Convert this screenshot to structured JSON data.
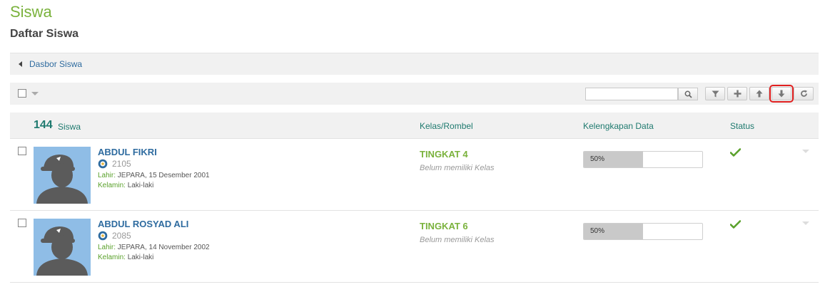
{
  "page": {
    "title": "Siswa",
    "subtitle": "Daftar Siswa"
  },
  "breadcrumb": {
    "link": "Dasbor Siswa"
  },
  "toolbar": {
    "search_value": "",
    "buttons": [
      "filter-icon",
      "plus-icon",
      "arrow-up-icon",
      "arrow-down-icon",
      "refresh-icon"
    ]
  },
  "list": {
    "count": "144",
    "count_label": "Siswa",
    "columns": {
      "kelas": "Kelas/Rombel",
      "kelengkapan": "Kelengkapan Data",
      "status": "Status"
    }
  },
  "students": [
    {
      "name": "ABDUL FIKRI",
      "nis": "2105",
      "lahir_label": "Lahir:",
      "lahir": "JEPARA, 15 Desember 2001",
      "kelamin_label": "Kelamin:",
      "kelamin": "Laki-laki",
      "tingkat": "TINGKAT 4",
      "kelas_note": "Belum memiliki Kelas",
      "progress_text": "50%",
      "progress_value": 0.5,
      "status_icon": "check-icon"
    },
    {
      "name": "ABDUL ROSYAD ALI",
      "nis": "2085",
      "lahir_label": "Lahir:",
      "lahir": "JEPARA, 14 November 2002",
      "kelamin_label": "Kelamin:",
      "kelamin": "Laki-laki",
      "tingkat": "TINGKAT 6",
      "kelas_note": "Belum memiliki Kelas",
      "progress_text": "50%",
      "progress_value": 0.5,
      "status_icon": "check-icon"
    }
  ],
  "colors": {
    "accent_green": "#7ab23c",
    "teal": "#1f7a6f",
    "link_blue": "#2e6b9f",
    "highlight": "#e01f1f"
  }
}
